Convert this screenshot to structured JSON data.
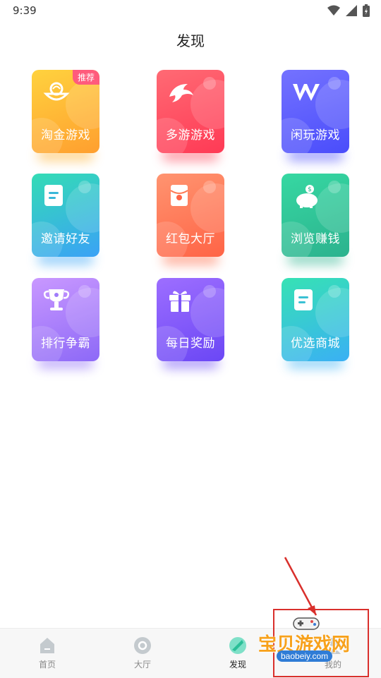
{
  "status_bar": {
    "time": "9:39"
  },
  "header": {
    "title": "发现"
  },
  "tiles": [
    {
      "label": "淘金游戏",
      "badge": "推荐",
      "icon": "coin-bowl-icon",
      "colors": [
        "#ffcf3e",
        "#ff9f2f"
      ]
    },
    {
      "label": "多游游戏",
      "icon": "dolphin-icon",
      "colors": [
        "#ff6470",
        "#ff3a55"
      ]
    },
    {
      "label": "闲玩游戏",
      "icon": "xw-logo-icon",
      "colors": [
        "#6f6dff",
        "#4a4dfb"
      ]
    },
    {
      "label": "邀请好友",
      "icon": "note-icon",
      "colors": [
        "#34d9b7",
        "#3aa6f6"
      ]
    },
    {
      "label": "红包大厅",
      "icon": "red-packet-icon",
      "colors": [
        "#ff8c68",
        "#ff6446"
      ]
    },
    {
      "label": "浏览赚钱",
      "icon": "piggy-bank-icon",
      "colors": [
        "#34d6a0",
        "#2db48f"
      ]
    },
    {
      "label": "排行争霸",
      "icon": "trophy-icon",
      "colors": [
        "#c795ff",
        "#8d69f7"
      ]
    },
    {
      "label": "每日奖励",
      "icon": "gift-icon",
      "colors": [
        "#9b6bff",
        "#6b47f5"
      ]
    },
    {
      "label": "优选商城",
      "icon": "note-icon",
      "colors": [
        "#36dfb6",
        "#3ab1f4"
      ]
    }
  ],
  "bottom_nav": [
    {
      "label": "首页",
      "icon": "home-icon",
      "active": false
    },
    {
      "label": "大厅",
      "icon": "hall-icon",
      "active": false
    },
    {
      "label": "发现",
      "icon": "discover-icon",
      "active": true
    },
    {
      "label": "我的",
      "icon": "profile-icon",
      "active": false
    }
  ],
  "watermark": {
    "title": "宝贝游戏网",
    "subtitle": "baobeiy.com"
  },
  "colors": {
    "annotation_red": "#d9302c",
    "nav_active": "#222222",
    "nav_inactive": "#888888"
  }
}
